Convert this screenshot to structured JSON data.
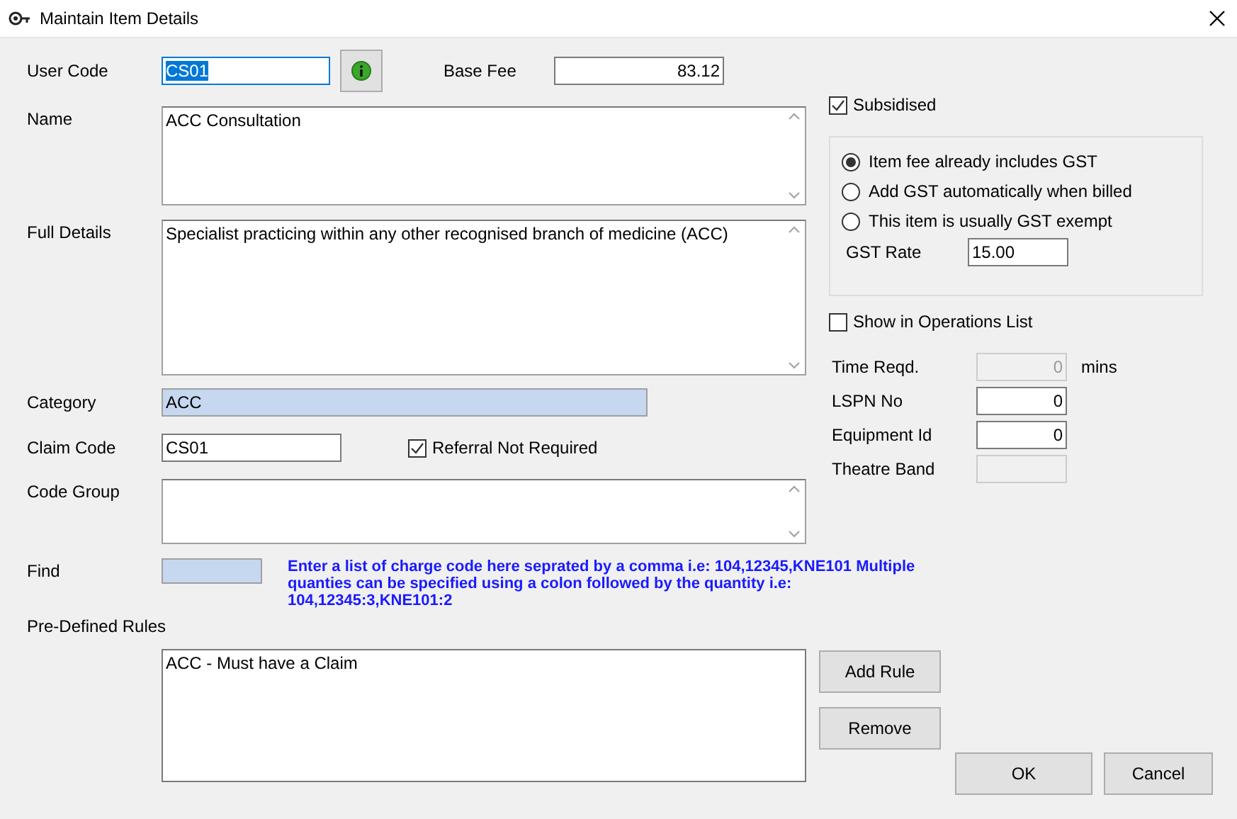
{
  "window": {
    "title": "Maintain Item Details"
  },
  "user_code": {
    "label": "User Code",
    "value": "CS01",
    "selected": true
  },
  "base_fee": {
    "label": "Base Fee",
    "value": "83.12"
  },
  "name": {
    "label": "Name",
    "value": "ACC Consultation"
  },
  "full_details": {
    "label": "Full Details",
    "value": "Specialist practicing within any other recognised branch of medicine (ACC)"
  },
  "category": {
    "label": "Category",
    "value": "ACC"
  },
  "claim_code": {
    "label": "Claim Code",
    "value": "CS01"
  },
  "referral_not_required": {
    "label": "Referral Not Required",
    "checked": true
  },
  "code_group": {
    "label": "Code Group"
  },
  "find": {
    "label": "Find",
    "hint": "Enter a list of charge code here seprated by a comma i.e: 104,12345,KNE101 Multiple quanties can be specified using a colon followed by the quantity i.e: 104,12345:3,KNE101:2"
  },
  "pre_defined_rules": {
    "label": "Pre-Defined Rules",
    "items": [
      "ACC - Must have a Claim"
    ]
  },
  "subsidised": {
    "label": "Subsidised",
    "checked": true
  },
  "gst_options": [
    {
      "label": "Item fee already includes GST",
      "selected": true
    },
    {
      "label": "Add GST automatically when billed",
      "selected": false
    },
    {
      "label": "This item is usually GST exempt",
      "selected": false
    }
  ],
  "gst_rate": {
    "label": "GST Rate",
    "value": "15.00"
  },
  "show_in_operations_list": {
    "label": "Show in Operations List",
    "checked": false
  },
  "operation_fields": [
    {
      "label": "Time Reqd.",
      "value": "0",
      "disabled": true,
      "unit": "mins"
    },
    {
      "label": "LSPN No",
      "value": "0",
      "disabled": false
    },
    {
      "label": "Equipment Id",
      "value": "0",
      "disabled": false
    },
    {
      "label": "Theatre Band",
      "disabled": true
    }
  ],
  "buttons": {
    "add_rule": "Add Rule",
    "remove": "Remove",
    "ok": "OK",
    "cancel": "Cancel"
  }
}
